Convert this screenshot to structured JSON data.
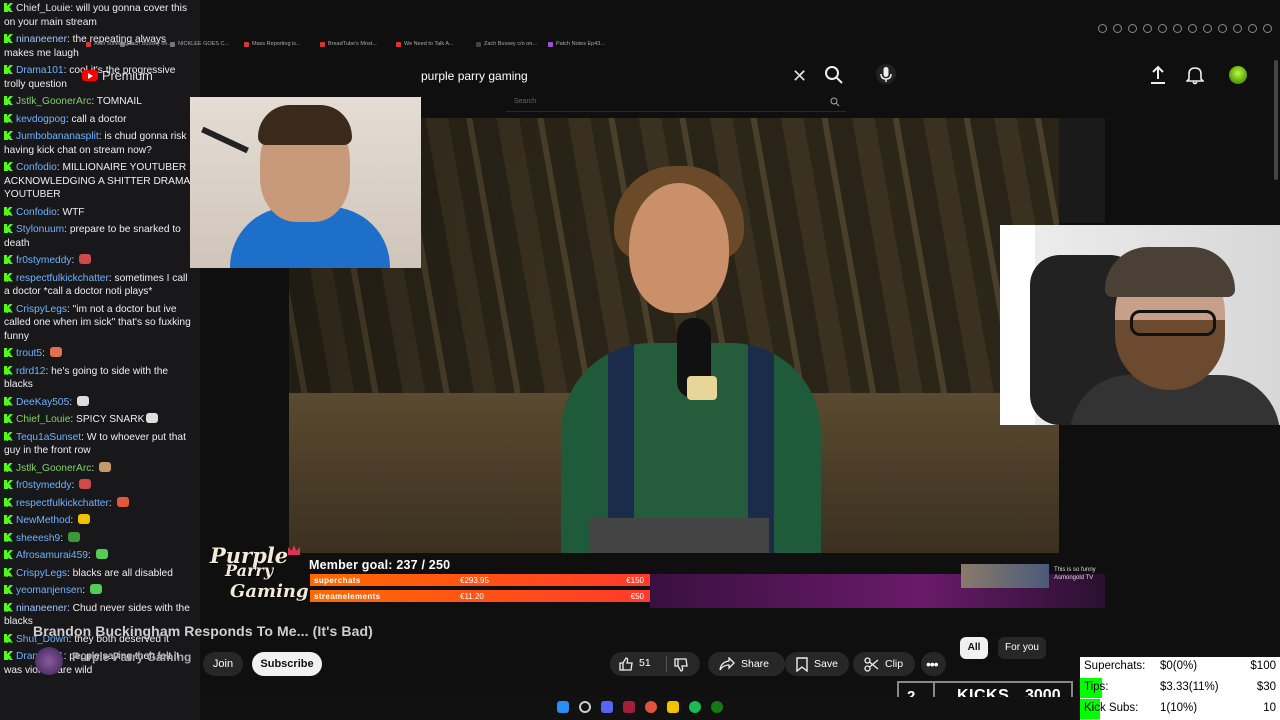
{
  "chat": {
    "messages": [
      {
        "user": "Chief_Louie",
        "text": "will you gonna cover this on your main stream",
        "color": "#e0e0e0"
      },
      {
        "user": "ninaneener",
        "text": "the repeating always makes me laugh",
        "color": "#9ec7ff"
      },
      {
        "user": "Drama101",
        "text": "cool it's the progressive trolly question",
        "color": "#6fb3ff"
      },
      {
        "user": "Jstlk_GoonerArc",
        "text": "TOMNAIL",
        "color": "#7fd36a"
      },
      {
        "user": "kevdogpog",
        "text": "call a doctor",
        "color": "#6fb3ff"
      },
      {
        "user": "Jumbobananasplit",
        "text": "is chud gonna risk having kick chat on stream now?",
        "color": "#6fb3ff"
      },
      {
        "user": "Confodio",
        "text": "MILLIONAIRE YOUTUBER ACKNOWLEDGING A SHITTER DRAMA YOUTUBER",
        "color": "#6fb3ff"
      },
      {
        "user": "Confodio",
        "text": "WTF",
        "color": "#6fb3ff"
      },
      {
        "user": "Stylonuum",
        "text": "prepare to be snarked to death",
        "color": "#6fb3ff"
      },
      {
        "user": "fr0stymeddy",
        "text": "",
        "color": "#6fb3ff",
        "emote": "#d04a4a"
      },
      {
        "user": "respectfulkickchatter",
        "text": "sometimes I call a doctor *call a doctor noti plays*",
        "color": "#6fb3ff"
      },
      {
        "user": "CrispyLegs",
        "text": "\"im not a doctor but ive called one when im sick\" that's so fuxking funny",
        "color": "#6fb3ff"
      },
      {
        "user": "trout5",
        "text": "",
        "color": "#6fb3ff",
        "emote": "#e07050"
      },
      {
        "user": "rdrd12",
        "text": "he's going to side with the blacks",
        "color": "#6fb3ff"
      },
      {
        "user": "DeeKay505",
        "text": "",
        "color": "#6fb3ff",
        "emote": "#dddddd"
      },
      {
        "user": "Chief_Louie",
        "text": "SPICY SNARK",
        "color": "#7fd36a",
        "emote": "#dddddd"
      },
      {
        "user": "Tequ1aSunset",
        "text": "W to whoever put that guy in the front row",
        "color": "#6fb3ff"
      },
      {
        "user": "Jstlk_GoonerArc",
        "text": "",
        "color": "#7fd36a",
        "emote": "#c49a6c"
      },
      {
        "user": "fr0stymeddy",
        "text": "",
        "color": "#6fb3ff",
        "emote": "#d04a4a"
      },
      {
        "user": "respectfulkickchatter",
        "text": "",
        "color": "#6fb3ff",
        "emote": "#e05a3a"
      },
      {
        "user": "NewMethod",
        "text": "",
        "color": "#6fb3ff",
        "emote": "#f2c200"
      },
      {
        "user": "sheeesh9",
        "text": "",
        "color": "#6fb3ff",
        "emote": "#3a9a3a"
      },
      {
        "user": "Afrosamurai459",
        "text": "",
        "color": "#6fb3ff",
        "emote": "#55cc55"
      },
      {
        "user": "CrispyLegs",
        "text": "blacks are all disabled",
        "color": "#6fb3ff"
      },
      {
        "user": "yeomanjensen",
        "text": "",
        "color": "#6fb3ff",
        "emote": "#55cc55"
      },
      {
        "user": "ninaneener",
        "text": "Chud never sides with the blacks",
        "color": "#9ec7ff"
      },
      {
        "user": "Shut_Down",
        "text": "they both deserved it",
        "color": "#6fb3ff"
      },
      {
        "user": "Drama101",
        "text": "people saying theh felt it was violent are wild",
        "color": "#6fb3ff"
      }
    ]
  },
  "browser": {
    "bookmarks": [
      "Zach Bussey on...",
      "After suffering a...",
      "NICKLEE GOES C...",
      "Mass Reporting is...",
      "BreadTube's Most...",
      "We Need to Talk A...",
      "Zach Bussey c/o on...",
      "Patch Notes Ep43..."
    ]
  },
  "youtube": {
    "logo_text": "Premium",
    "search_value": "purple parry gaming",
    "search2_placeholder": "Search",
    "video_title": "Brandon Buckingham Responds To Me... (It's Bad)",
    "channel_name": "Purple Parry Gaming",
    "join_label": "Join",
    "subscribe_label": "Subscribe",
    "like_count": "51",
    "share_label": "Share",
    "save_label": "Save",
    "clip_label": "Clip",
    "filter_all": "All",
    "filter_foryou": "For you"
  },
  "overlay": {
    "logo_line1": "Purple",
    "logo_line2": "Parry",
    "logo_line3": "Gaming",
    "member_goal": "Member goal: 237 / 250",
    "bar1_label": "superchats",
    "bar1_value": "€293.95",
    "bar1_goal": "€150",
    "bar2_label": "streamelements",
    "bar2_value": "€11.20",
    "bar2_goal": "€50",
    "thumb_caption_1": "This is so funny",
    "thumb_caption_2": "Asmongold TV"
  },
  "stats": {
    "superchats_label": "Superchats:",
    "superchats_value": "$0(0%)",
    "superchats_goal": "$100",
    "superchats_fill": 0,
    "tips_label": "Tips:",
    "tips_value": "$3.33(11%)",
    "tips_goal": "$30",
    "tips_fill": 0.11,
    "kicksubs_label": "Kick Subs:",
    "kicksubs_value": "1(10%)",
    "kicksubs_goal": "10",
    "kicksubs_fill": 0.1
  },
  "kicks": {
    "count": "2",
    "label": "KICKS",
    "goal": "3000"
  },
  "colors": {
    "kick_green": "#53fc18",
    "youtube_red": "#ff0000",
    "overlay_orange": "#ff5a1a"
  }
}
